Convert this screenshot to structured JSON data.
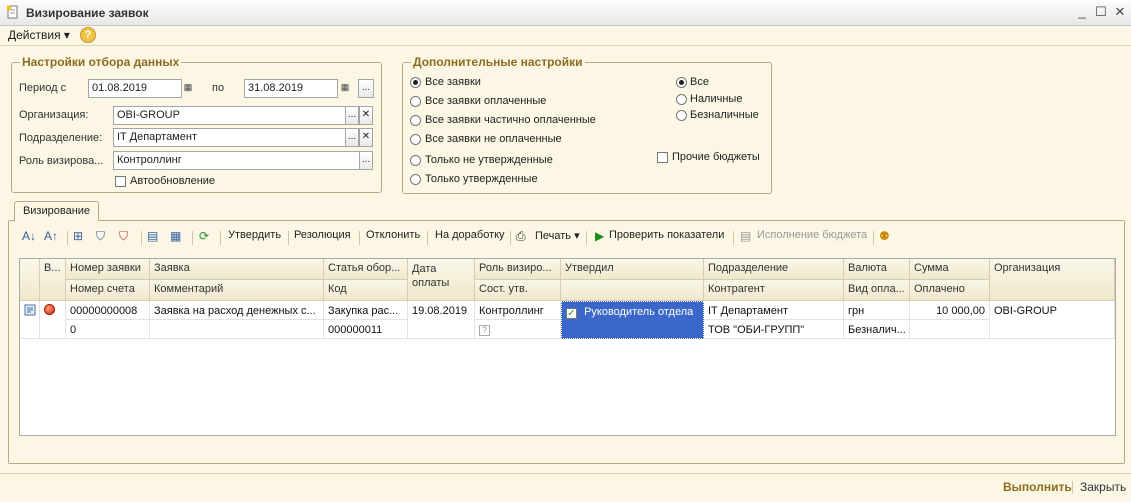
{
  "window": {
    "title": "Визирование заявок",
    "minimize": "_",
    "maximize": "☐",
    "close": "✕"
  },
  "menu": {
    "actions": "Действия ▾",
    "help": "?"
  },
  "filter": {
    "legend": "Настройки отбора данных",
    "period_label": "Период с",
    "date_from": "01.08.2019",
    "to_label": "по",
    "date_to": "31.08.2019",
    "ellipsis": "...",
    "org_label": "Организация:",
    "org_value": "OBI-GROUP",
    "dept_label": "Подразделение:",
    "dept_value": "IT Департамент",
    "role_label": "Роль визирова...",
    "role_value": "Контроллинг",
    "autoupdate": "Автообновление",
    "clear": "✕"
  },
  "extra": {
    "legend": "Дополнительные настройки",
    "options": [
      "Все заявки",
      "Все заявки оплаченные",
      "Все заявки частично оплаченные",
      "Все заявки не оплаченные",
      "Только не утвержденные",
      "Только утвержденные"
    ],
    "pay_options": [
      "Все",
      "Наличные",
      "Безналичные"
    ],
    "other_budgets": "Прочие бюджеты"
  },
  "tab": {
    "label": "Визирование"
  },
  "toolbar": {
    "approve": "Утвердить",
    "resolution": "Резолюция",
    "reject": "Отклонить",
    "rework": "На доработку",
    "print": "Печать ▾",
    "check": "Проверить показатели",
    "budget": "Исполнение бюджета"
  },
  "grid": {
    "headers_top": [
      "В...",
      "Номер заявки",
      "Заявка",
      "Статья обор...",
      "Дата оплаты",
      "Роль визиро...",
      "Утвердил",
      "Подразделение",
      "Валюта",
      "Сумма",
      "Организация"
    ],
    "headers_bottom": [
      "Номер счета",
      "Комментарий",
      "Код",
      "Сост. утв.",
      "Контрагент",
      "Вид опла...",
      "Оплачено"
    ],
    "row": {
      "number": "00000000008",
      "request": "Заявка на расход денежных с...",
      "article": "Закупка рас...",
      "pay_date": "19.08.2019",
      "role": "Контроллинг",
      "approved_by": "Руководитель отдела",
      "department": "IT Департамент",
      "currency": "грн",
      "amount": "10 000,00",
      "organization": "OBI-GROUP",
      "invoice": "0",
      "code": "000000011",
      "status": "?",
      "counterparty": "ТОВ \"ОБИ-ГРУПП\"",
      "pay_type": "Безналич..."
    }
  },
  "footer": {
    "run": "Выполнить",
    "close": "Закрыть"
  },
  "colors": {
    "background": "#fbf7e4",
    "accent": "#8c6d20",
    "selection": "#3a67c9"
  }
}
